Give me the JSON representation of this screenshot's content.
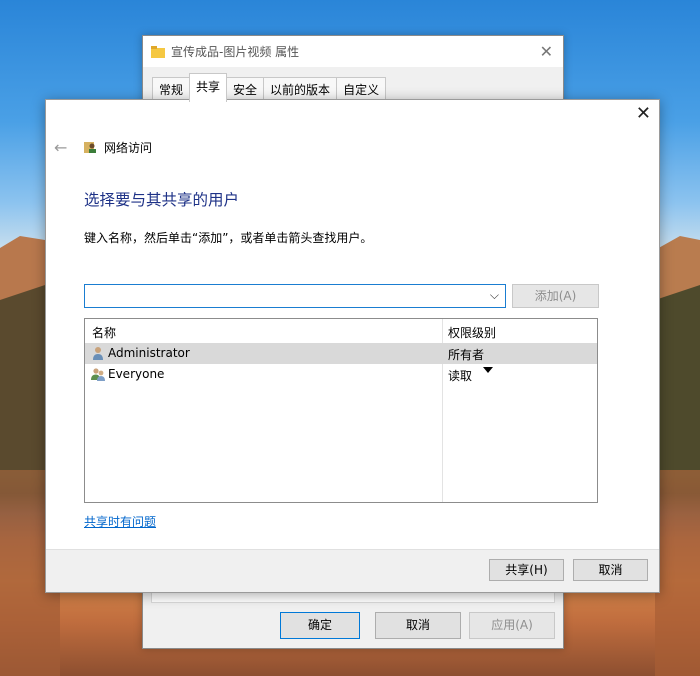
{
  "back_window": {
    "title": "宣传成品-图片视频 属性",
    "tabs": [
      "常规",
      "共享",
      "安全",
      "以前的版本",
      "自定义"
    ],
    "active_tab": 1,
    "ok_label": "确定",
    "cancel_label": "取消",
    "apply_label": "应用(A)"
  },
  "dialog": {
    "nav_title": "网络访问",
    "heading": "选择要与其共享的用户",
    "instruction": "键入名称，然后单击“添加”，或者单击箭头查找用户。",
    "combo_value": "",
    "add_label": "添加(A)",
    "columns": {
      "name": "名称",
      "permission": "权限级别"
    },
    "rows": [
      {
        "name": "Administrator",
        "permission": "所有者",
        "selected": true,
        "icon": "user-icon"
      },
      {
        "name": "Everyone",
        "permission": "读取",
        "selected": false,
        "icon": "users-icon"
      }
    ],
    "help_link": "共享时有问题",
    "share_label": "共享(H)",
    "cancel_label": "取消"
  }
}
